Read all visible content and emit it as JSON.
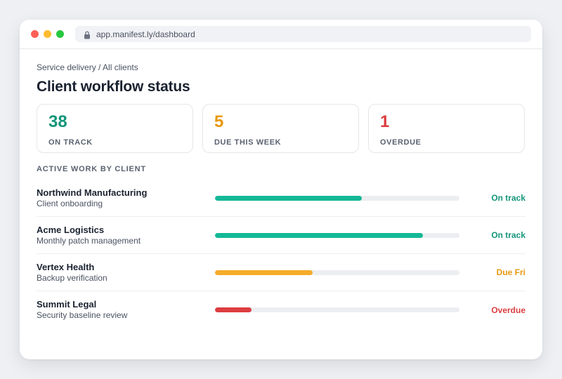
{
  "browser": {
    "url": "app.manifest.ly/dashboard"
  },
  "breadcrumb": "Service delivery / All clients",
  "page_title": "Client workflow status",
  "summary": [
    {
      "value": "38",
      "label": "ON TRACK",
      "color": "#14967a"
    },
    {
      "value": "5",
      "label": "DUE THIS WEEK",
      "color": "#e8980f"
    },
    {
      "value": "1",
      "label": "OVERDUE",
      "color": "#dc3d40"
    }
  ],
  "section_title": "ACTIVE WORK BY CLIENT",
  "clients": [
    {
      "name": "Northwind Manufacturing",
      "workflow": "Client onboarding",
      "progress": 0.6,
      "status": "On track",
      "status_color": "#14967a",
      "bar_color": "#14b896"
    },
    {
      "name": "Acme Logistics",
      "workflow": "Monthly patch management",
      "progress": 0.85,
      "status": "On track",
      "status_color": "#14967a",
      "bar_color": "#14b896"
    },
    {
      "name": "Vertex Health",
      "workflow": "Backup verification",
      "progress": 0.4,
      "status": "Due Fri",
      "status_color": "#e8980f",
      "bar_color": "#f5ac2a"
    },
    {
      "name": "Summit Legal",
      "workflow": "Security baseline review",
      "progress": 0.15,
      "status": "Overdue",
      "status_color": "#dc3d40",
      "bar_color": "#dc3d40"
    }
  ]
}
